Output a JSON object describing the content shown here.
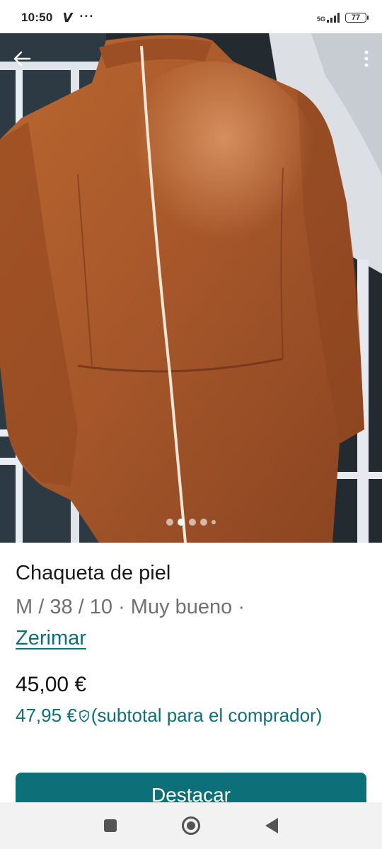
{
  "status_bar": {
    "time": "10:50",
    "carrier_icon": "V",
    "more_icon": "···",
    "network": "5G",
    "battery": "77"
  },
  "photo": {
    "description_icon": "leather-jacket-photo",
    "pager": {
      "count": 5,
      "active_index": 1
    }
  },
  "product": {
    "title": "Chaqueta de piel",
    "meta": "M / 38 / 10 · Muy bueno ·",
    "seller": "Zerimar",
    "price": "45,00 €",
    "buyer_price": "47,95 €",
    "buyer_note": "(subtotal para el comprador)"
  },
  "actions": {
    "primary_label": "Destacar"
  },
  "colors": {
    "accent": "#0d7079",
    "leather": "#a8582a"
  }
}
